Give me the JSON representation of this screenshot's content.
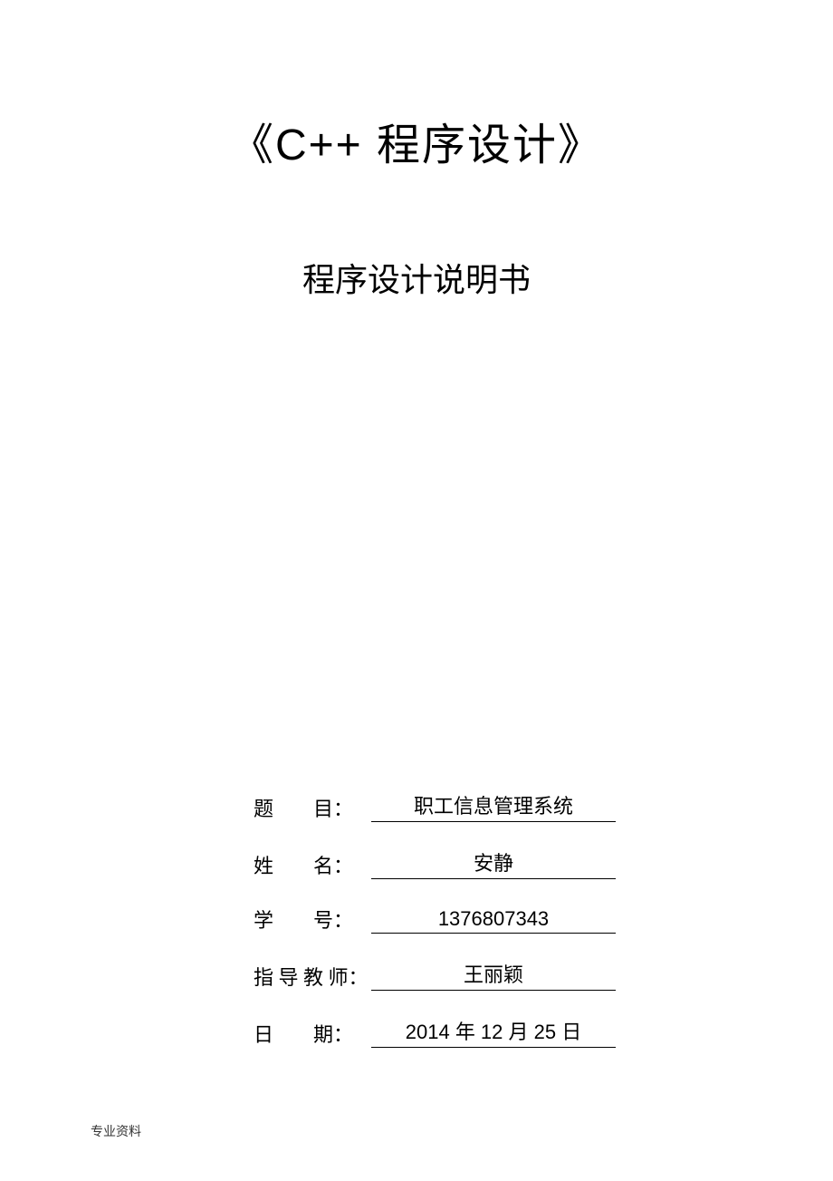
{
  "title": "《C++ 程序设计》",
  "subtitle": "程序设计说明书",
  "fields": {
    "topic": {
      "label": "题        目：",
      "value": "职工信息管理系统"
    },
    "name": {
      "label": "姓        名：",
      "value": "安静"
    },
    "student_id": {
      "label": "学        号：",
      "value": "1376807343"
    },
    "advisor": {
      "label": "指 导 教 师：",
      "value": "王丽颖"
    },
    "date": {
      "label": "日        期：",
      "value": "2014 年 12 月 25 日"
    }
  },
  "footer": "专业资料"
}
